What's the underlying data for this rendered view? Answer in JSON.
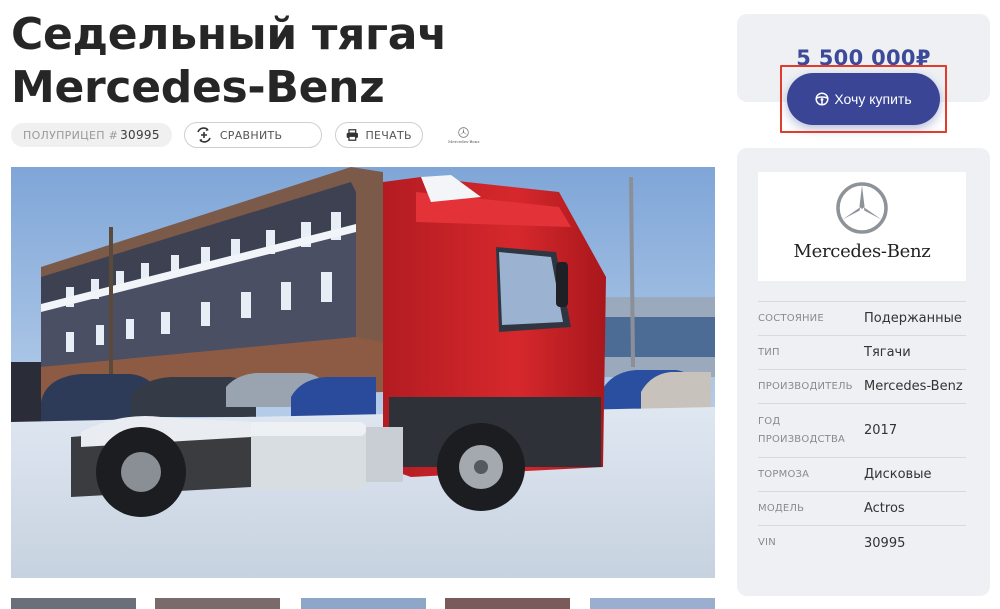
{
  "listing": {
    "title": "Седельный тягач Mercedes-Benz",
    "lot_prefix": "ПОЛУПРИЦЕП #",
    "lot_number": "30995",
    "compare_label": "СРАВНИТЬ",
    "print_label": "ПЕЧАТЬ",
    "brand_mini": "Mercedes-Benz"
  },
  "sidebar": {
    "price": "5 500 000₽",
    "buy_label": "Хочу купить",
    "brand_logo_text": "Mercedes-Benz",
    "specs": [
      {
        "label": "СОСТОЯНИЕ",
        "value": "Подержанные"
      },
      {
        "label": "ТИП",
        "value": "Тягачи"
      },
      {
        "label": "ПРОИЗВОДИТЕЛЬ",
        "value": "Mercedes-Benz"
      },
      {
        "label": "ГОД ПРОИЗВОДСТВА",
        "value": "2017"
      },
      {
        "label": "ТОРМОЗА",
        "value": "Дисковые"
      },
      {
        "label": "МОДЕЛЬ",
        "value": "Actros"
      },
      {
        "label": "VIN",
        "value": "30995"
      }
    ]
  },
  "colors": {
    "accent": "#3a4596",
    "price": "#3d4a9a",
    "highlight": "#e13b2c",
    "card_bg": "#eef0f3"
  },
  "icons": [
    "compare-icon",
    "print-icon",
    "steering-wheel-icon",
    "mercedes-star-icon"
  ]
}
